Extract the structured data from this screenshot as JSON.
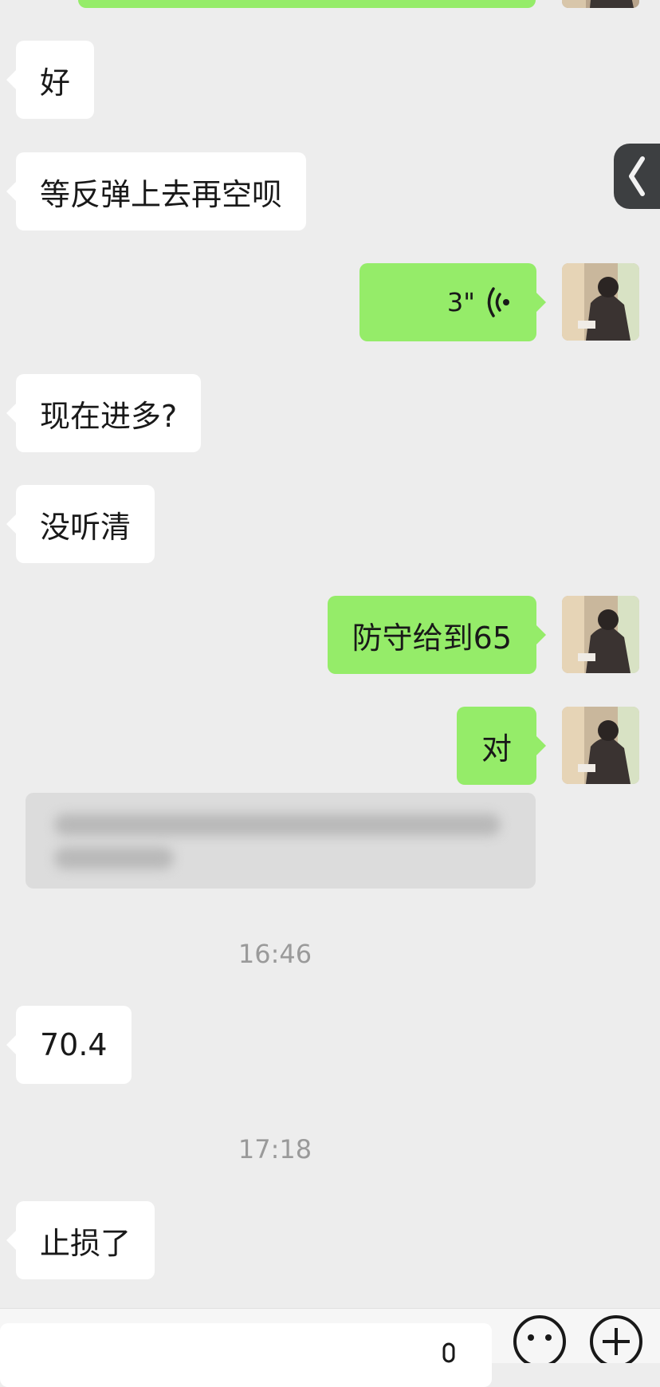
{
  "chat": {
    "messages": [
      {
        "side": "in",
        "text": "好"
      },
      {
        "side": "in",
        "text": "等反弹上去再空呗"
      },
      {
        "side": "out",
        "type": "voice",
        "duration": "3\""
      },
      {
        "side": "in",
        "text": "现在进多?"
      },
      {
        "side": "in",
        "text": "没听清"
      },
      {
        "side": "out",
        "text": "防守给到65"
      },
      {
        "side": "out",
        "text": "对"
      },
      {
        "side": "in",
        "text": "70.4"
      },
      {
        "side": "in",
        "text": "止损了"
      }
    ],
    "timestamps": [
      "16:46",
      "17:18"
    ]
  },
  "icons": {
    "side_tab": "chevron-left-icon",
    "voice": "voice-wave-icon",
    "mic": "microphone-icon",
    "emoji": "emoji-icon",
    "more": "plus-circle-icon"
  },
  "colors": {
    "background": "#ededed",
    "outgoing_bubble": "#95ec69",
    "incoming_bubble": "#ffffff"
  }
}
